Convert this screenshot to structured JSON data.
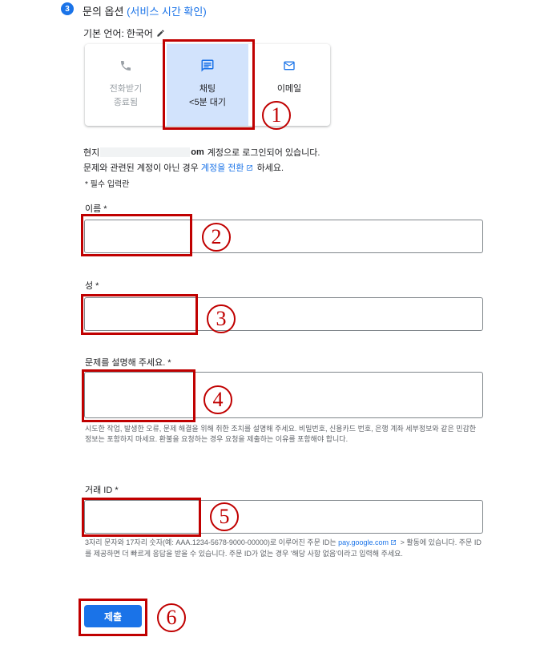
{
  "section": {
    "step_number": "3",
    "title": "문의 옵션",
    "link_text": "(서비스 시간 확인)"
  },
  "language": {
    "label": "기본 언어:",
    "value": "한국어",
    "icon": "pencil-icon"
  },
  "contact_options": [
    {
      "icon": "phone-icon",
      "line1": "전화받기",
      "line2": "종료됨",
      "state": "disabled"
    },
    {
      "icon": "chat-icon",
      "line1": "채팅",
      "line2": "<5분 대기",
      "state": "selected"
    },
    {
      "icon": "email-icon",
      "line1": "이메일",
      "line2": "",
      "state": "available"
    }
  ],
  "account": {
    "prefix": "현지",
    "suffix": "om",
    "signed_in_text": "계정으로 로그인되어 있습니다.",
    "switch_prefix": "문제와 관련된 계정이 아닌 경우",
    "switch_link": "계정을 전환",
    "switch_suffix": "하세요.",
    "required_note": "* 필수 입력란"
  },
  "fields": {
    "first_name": {
      "label": "이름 *",
      "value": ""
    },
    "last_name": {
      "label": "성 *",
      "value": ""
    },
    "description": {
      "label": "문제를 설명해 주세요. *",
      "value": "",
      "helper": "시도한 작업, 발생한 오류, 문제 해결을 위해 취한 조치를 설명해 주세요. 비밀번호, 신용카드 번호, 은행 계좌 세부정보와 같은 민감한 정보는 포함하지 마세요. 환불을 요청하는 경우 요청을 제출하는 이유를 포함해야 합니다."
    },
    "transaction_id": {
      "label": "거래 ID *",
      "value": "",
      "helper_prefix": "3자리 문자와 17자리 숫자(예: AAA.1234-5678-9000-00000)로 이루어진 주문 ID는",
      "helper_link": "pay.google.com",
      "helper_suffix": "> 활동에 있습니다. 주문 ID를 제공하면 더 빠르게 응답을 받을 수 있습니다. 주문 ID가 없는 경우 '해당 사항 없음'이라고 입력해 주세요."
    }
  },
  "submit_label": "제출",
  "annotations": [
    "1",
    "2",
    "3",
    "4",
    "5",
    "6"
  ],
  "colors": {
    "accent": "#1a73e8",
    "selected_bg": "#d2e3fc",
    "annotation_red": "#c00000",
    "disabled_text": "#9aa0a6"
  }
}
